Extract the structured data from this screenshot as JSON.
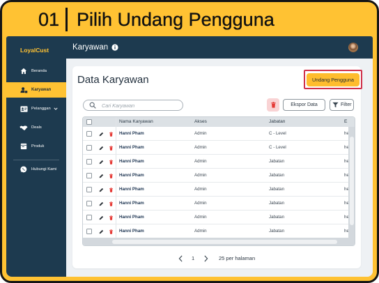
{
  "step": {
    "number": "01",
    "title": "Pilih Undang Pengguna"
  },
  "colors": {
    "accent": "#FFC233",
    "sidebar": "#1D3A4F",
    "canvas": "#EEF1F4",
    "danger": "#E53935",
    "highlight_border": "#D0304A"
  },
  "sidebar": {
    "logo": "LoyalCust",
    "items": [
      {
        "label": "Beranda",
        "icon": "home-icon",
        "active": false
      },
      {
        "label": "Karyawan",
        "icon": "employee-icon",
        "active": true
      },
      {
        "label": "Pelanggan",
        "icon": "customer-card-icon",
        "active": false,
        "submenu_icon": "chevron-down-icon"
      },
      {
        "label": "Deals",
        "icon": "handshake-icon",
        "active": false
      },
      {
        "label": "Produk",
        "icon": "product-icon",
        "active": false
      },
      {
        "label": "Hubungi Kami",
        "icon": "whatsapp-icon",
        "active": false
      }
    ]
  },
  "topbar": {
    "title": "Karyawan",
    "info_icon": "info-icon",
    "avatar_icon": "user-avatar-icon"
  },
  "page": {
    "title": "Data Karyawan",
    "invite_button_label": "Undang Pengguna",
    "invite_button_highlighted": true
  },
  "toolbar": {
    "search_icon": "search-icon",
    "search_placeholder": "Cari Karyawan",
    "delete_icon": "trash-icon",
    "export_label": "Ekspor Data",
    "filter_icon": "filter-icon",
    "filter_label": "Filter"
  },
  "table": {
    "columns": [
      "Nama Karyawan",
      "Akses",
      "Jabatan",
      "E"
    ],
    "rows": [
      {
        "name": "Hanni Pham",
        "access": "Admin",
        "position": "C - Level",
        "email": "he"
      },
      {
        "name": "Hanni Pham",
        "access": "Admin",
        "position": "C - Level",
        "email": "he"
      },
      {
        "name": "Hanni Pham",
        "access": "Admin",
        "position": "Jabatan",
        "email": "he"
      },
      {
        "name": "Hanni Pham",
        "access": "Admin",
        "position": "Jabatan",
        "email": "he"
      },
      {
        "name": "Hanni Pham",
        "access": "Admin",
        "position": "Jabatan",
        "email": "he"
      },
      {
        "name": "Hanni Pham",
        "access": "Admin",
        "position": "Jabatan",
        "email": "he"
      },
      {
        "name": "Hanni Pham",
        "access": "Admin",
        "position": "Jabatan",
        "email": "he"
      },
      {
        "name": "Hanni Pham",
        "access": "Admin",
        "position": "Jabatan",
        "email": "he"
      }
    ]
  },
  "pagination": {
    "prev_icon": "chevron-left-icon",
    "current_page": "1",
    "next_icon": "chevron-right-icon",
    "per_page_label": "25 per halaman"
  }
}
